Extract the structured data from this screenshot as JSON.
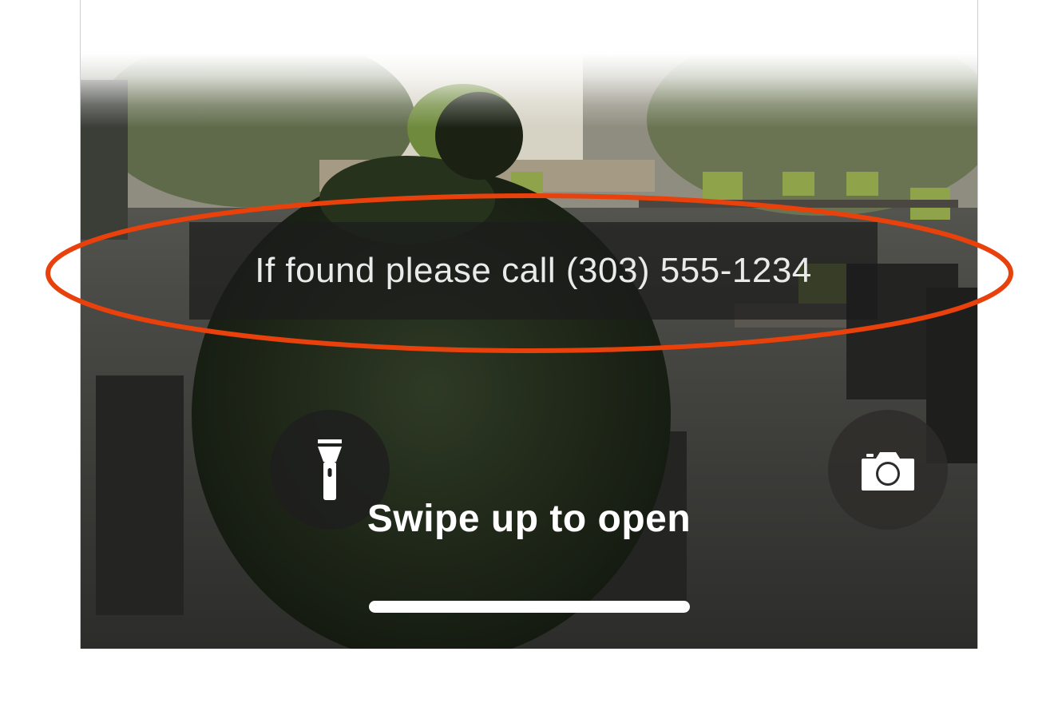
{
  "lock_screen": {
    "owner_message": "If found please call (303) 555-1234",
    "swipe_label": "Swipe up to open"
  },
  "controls": {
    "flashlight_icon": "flashlight-icon",
    "camera_icon": "camera-icon"
  },
  "colors": {
    "highlight_ring": "#e8410c",
    "banner_bg": "#1c1c1c",
    "text": "#ffffff"
  }
}
